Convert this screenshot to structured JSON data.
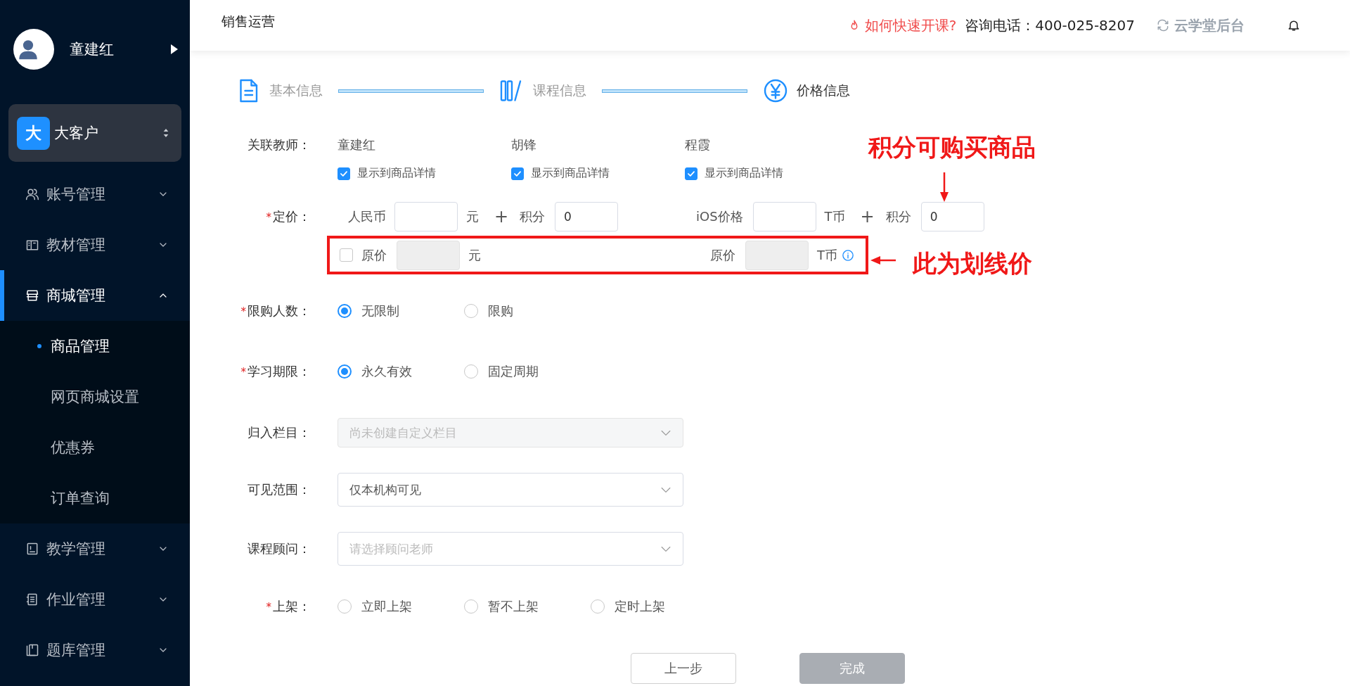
{
  "sidebar": {
    "user": {
      "name": "童建红"
    },
    "org": {
      "badge": "大",
      "name": "大客户"
    },
    "menu": [
      {
        "label": "账号管理",
        "expanded": false,
        "selected": false
      },
      {
        "label": "教材管理",
        "expanded": false,
        "selected": false
      },
      {
        "label": "商城管理",
        "expanded": true,
        "selected": true,
        "children": [
          {
            "label": "商品管理",
            "selected": true
          },
          {
            "label": "网页商城设置",
            "selected": false
          },
          {
            "label": "优惠券",
            "selected": false
          },
          {
            "label": "订单查询",
            "selected": false
          }
        ]
      },
      {
        "label": "教学管理",
        "expanded": false,
        "selected": false
      },
      {
        "label": "作业管理",
        "expanded": false,
        "selected": false
      },
      {
        "label": "题库管理",
        "expanded": false,
        "selected": false
      }
    ]
  },
  "header": {
    "title": "销售运营",
    "help_link": "如何快速开课?",
    "phone": "咨询电话：400-025-8207",
    "backend_link": "云学堂后台"
  },
  "steps": [
    {
      "label": "基本信息",
      "selected": false
    },
    {
      "label": "课程信息",
      "selected": false
    },
    {
      "label": "价格信息",
      "selected": true
    }
  ],
  "form": [
    {
      "kind": "teachers",
      "label": "关联教师：",
      "teachers": [
        {
          "name": "童建红",
          "checkbox_label": "显示到商品详情",
          "checked": true
        },
        {
          "name": "胡锋",
          "checkbox_label": "显示到商品详情",
          "checked": true
        },
        {
          "name": "程霞",
          "checkbox_label": "显示到商品详情",
          "checked": true
        }
      ]
    },
    {
      "kind": "pricing",
      "required_mark": "*",
      "label": "定价：",
      "groups": [
        {
          "currency_label": "人民币",
          "unit": "元",
          "plus": "+",
          "points_label": "积分",
          "points_value": "0"
        },
        {
          "currency_label": "iOS价格",
          "unit": "T币",
          "plus": "+",
          "points_label": "积分",
          "points_value": "0"
        }
      ]
    },
    {
      "kind": "original_price",
      "highlighted": true,
      "checked": false,
      "groups": [
        {
          "label": "原价",
          "unit": "元",
          "disabled": true
        },
        {
          "label": "原价",
          "unit": "T币",
          "disabled": true,
          "info": true
        }
      ]
    },
    {
      "kind": "radio",
      "required_mark": "*",
      "label": "限购人数：",
      "options": [
        {
          "label": "无限制",
          "selected": true
        },
        {
          "label": "限购",
          "selected": false
        }
      ]
    },
    {
      "kind": "radio",
      "required_mark": "*",
      "label": "学习期限：",
      "options": [
        {
          "label": "永久有效",
          "selected": true
        },
        {
          "label": "固定周期",
          "selected": false
        }
      ]
    },
    {
      "kind": "select",
      "label": "归入栏目：",
      "placeholder": "尚未创建自定义栏目",
      "disabled": true
    },
    {
      "kind": "select",
      "label": "可见范围：",
      "value": "仅本机构可见",
      "disabled": false
    },
    {
      "kind": "select",
      "label": "课程顾问：",
      "placeholder": "请选择顾问老师",
      "disabled": false
    },
    {
      "kind": "radio",
      "required_mark": "*",
      "label": "上架：",
      "options": [
        {
          "label": "立即上架",
          "selected": false
        },
        {
          "label": "暂不上架",
          "selected": false
        },
        {
          "label": "定时上架",
          "selected": false
        }
      ]
    },
    {
      "kind": "buttons",
      "buttons": [
        {
          "label": "上一步",
          "kind": "secondary",
          "disabled": false
        },
        {
          "label": "完成",
          "kind": "primary",
          "disabled": true
        }
      ]
    }
  ],
  "annotations": [
    {
      "text": "积分可购买商品"
    },
    {
      "text": "此为划线价"
    }
  ]
}
